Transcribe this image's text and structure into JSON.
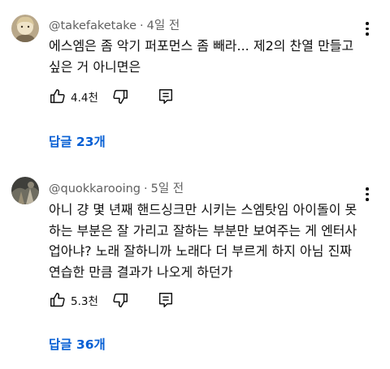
{
  "comments": [
    {
      "author": "@takefaketake",
      "time": "4일 전",
      "text_lines": [
        "에스엠은 좀 악기 퍼포먼스 좀 빼라... 제2의 찬열 만들고",
        "싶은 거 아니면은"
      ],
      "likes": "4.4천",
      "replies_label": "답글 23개",
      "icons": [
        "avatar",
        "thumbs-up-icon",
        "thumbs-down-icon",
        "reply-icon",
        "more-vert-icon"
      ]
    },
    {
      "author": "@quokkarooing",
      "time": "5일 전",
      "text_lines": [
        "아니 걍 몇 년째 핸드싱크만 시키는 스엠탓임 아이돌이 못",
        "하는 부분은 잘 가리고 잘하는 부분만 보여주는 게 엔터사",
        "업아냐? 노래 잘하니까 노래다 더 부르게 하지 아님 진짜",
        "연습한 만큼 결과가 나오게 하던가"
      ],
      "likes": "5.3천",
      "replies_label": "답글 36개",
      "icons": [
        "avatar",
        "thumbs-up-icon",
        "thumbs-down-icon",
        "reply-icon",
        "more-vert-icon"
      ]
    }
  ],
  "colors": {
    "text": "#0f0f0f",
    "meta": "#606060",
    "link": "#065fd4",
    "background": "#ffffff"
  }
}
